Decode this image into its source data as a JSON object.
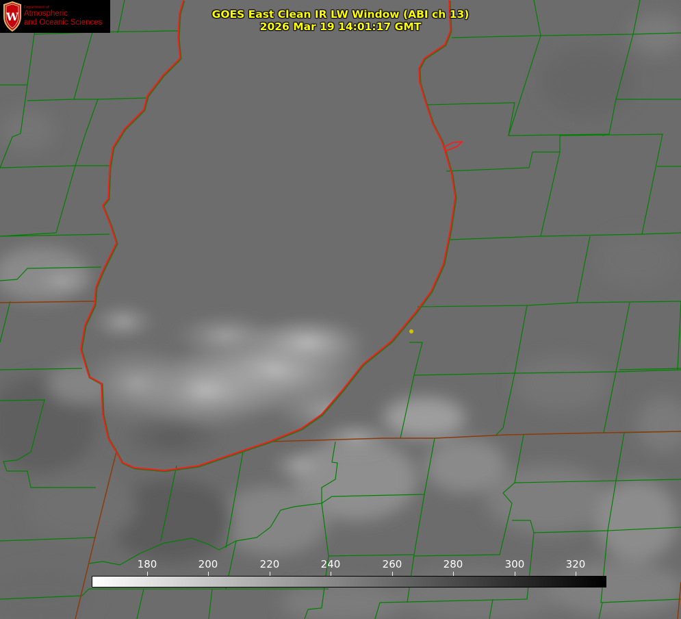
{
  "title": {
    "line1": "GOES East Clean IR LW Window (ABI ch 13)",
    "line2": "2026 Mar 19 14:01:17 GMT"
  },
  "logo": {
    "dept": "Department of",
    "line1": "Atmospheric",
    "line2": "and Oceanic Sciences",
    "crest_letter": "W"
  },
  "colorbar": {
    "min": 162,
    "max": 330,
    "ticks": [
      "180",
      "200",
      "220",
      "240",
      "260",
      "280",
      "300",
      "320"
    ],
    "color_warm": "#000000",
    "color_cold": "#ffffff"
  },
  "colors": {
    "title": "#ffff00",
    "county_borders": "#008000",
    "lake_shoreline": "#ff0000",
    "state_border": "#8b3a0a",
    "lake_fill": "#6d6d6d",
    "marker": "#d4c400"
  }
}
